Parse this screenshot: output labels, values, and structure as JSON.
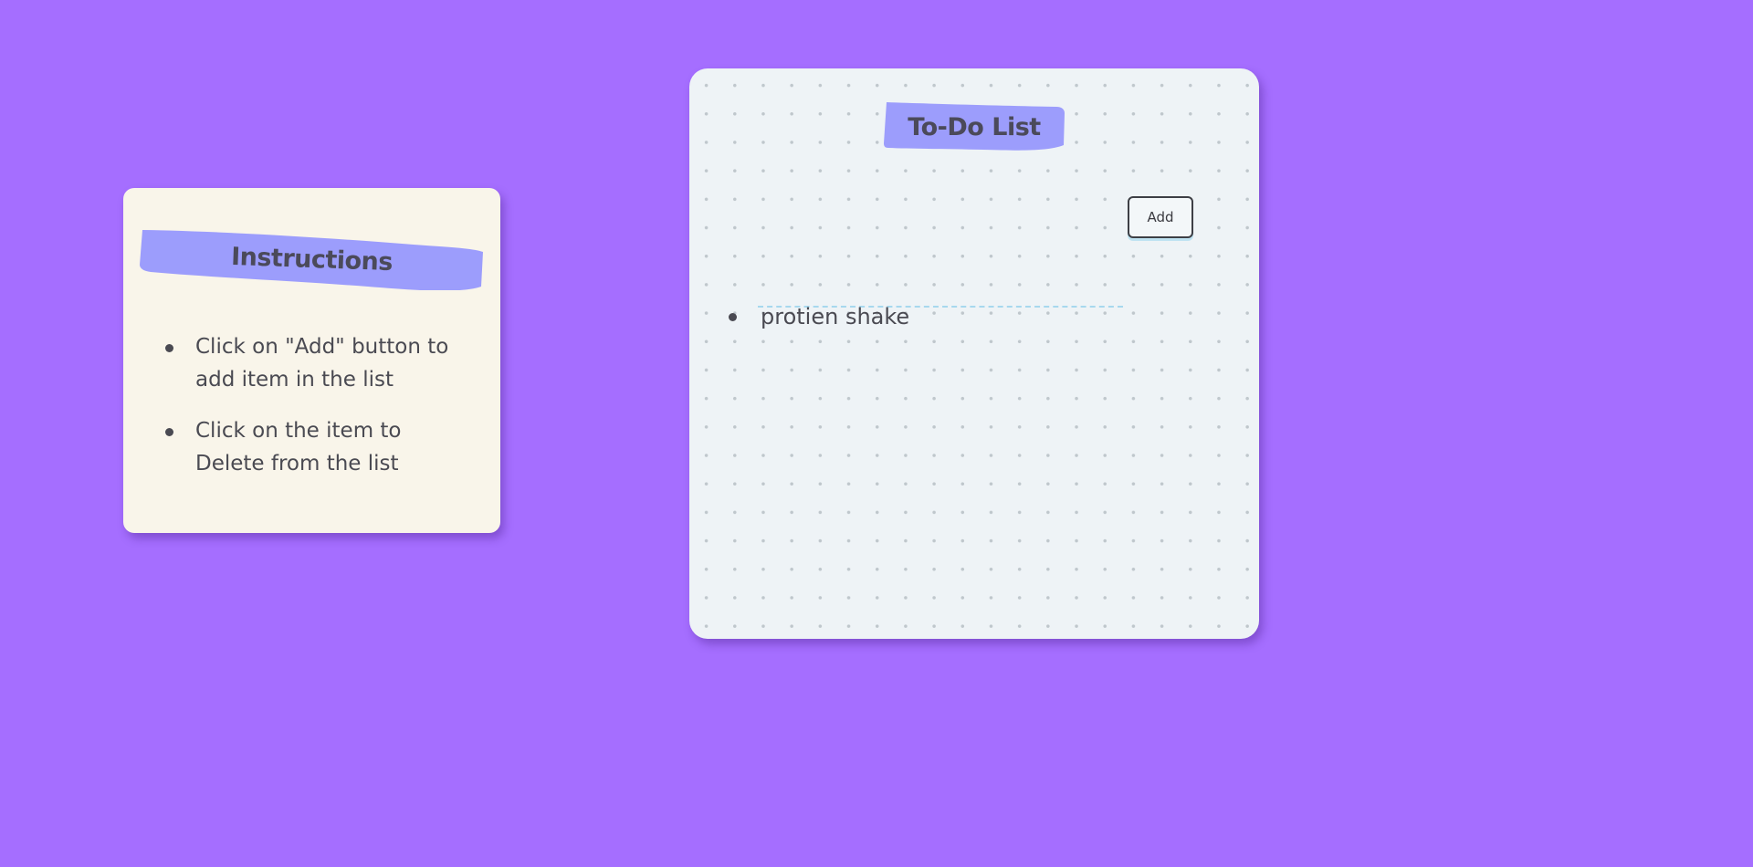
{
  "colors": {
    "background": "#a56eff",
    "banner": "#9c9dfc",
    "instructions_card": "#f9f5ea",
    "todo_card": "#eef3f6",
    "input_underline": "#a7d8ee"
  },
  "instructions": {
    "title": "Instructions",
    "items": [
      {
        "text": "Click on \"Add\" button to add item in the list"
      },
      {
        "text": "Click on the item to Delete from the list"
      }
    ]
  },
  "todo": {
    "title": "To-Do List",
    "input": {
      "value": "",
      "placeholder": ""
    },
    "add_label": "Add",
    "items": [
      {
        "text": "protien shake"
      }
    ]
  }
}
